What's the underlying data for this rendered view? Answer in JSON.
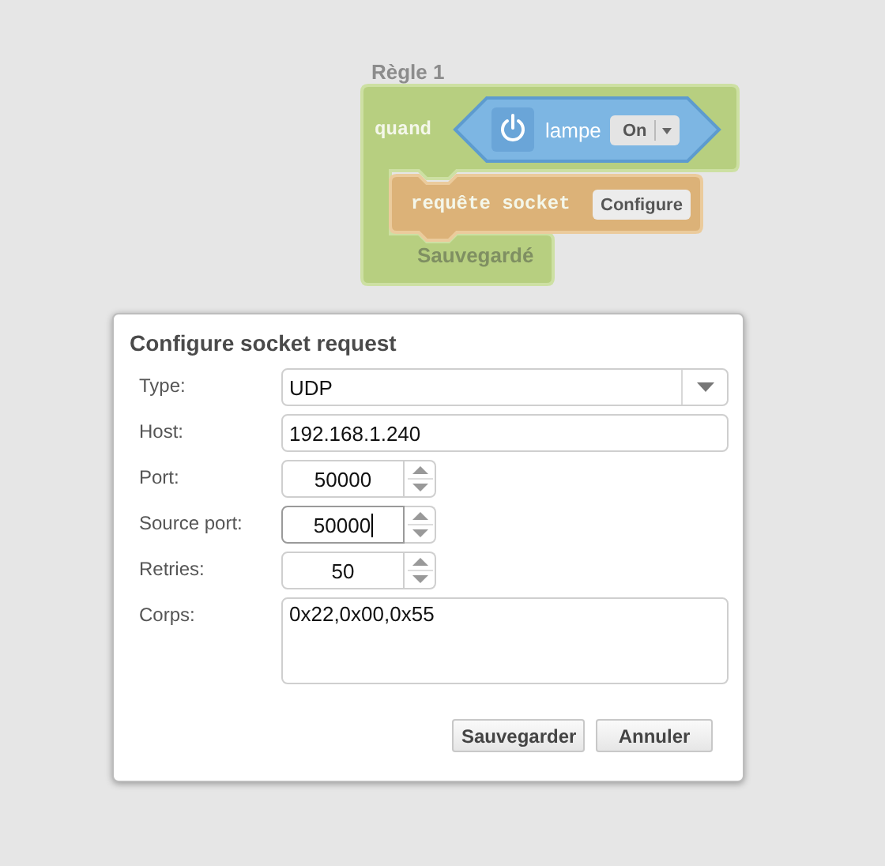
{
  "rule": {
    "title": "Règle 1",
    "when_label": "quand",
    "trigger": {
      "device": "lampe",
      "state": "On"
    },
    "action": {
      "label": "requête socket",
      "button": "Configure"
    },
    "status": "Sauvegardé"
  },
  "dialog": {
    "title": "Configure socket request",
    "fields": [
      {
        "kind": "select",
        "label": "Type:",
        "value": "UDP",
        "focused": false
      },
      {
        "kind": "text",
        "label": "Host:",
        "value": "192.168.1.240",
        "focused": false
      },
      {
        "kind": "number",
        "label": "Port:",
        "value": "50000",
        "focused": false
      },
      {
        "kind": "number",
        "label": "Source port:",
        "value": "50000",
        "focused": true
      },
      {
        "kind": "number",
        "label": "Retries:",
        "value": "50",
        "focused": false
      },
      {
        "kind": "textarea",
        "label": "Corps:",
        "value": "0x22,0x00,0x55",
        "focused": false
      }
    ],
    "buttons": [
      "Sauvegarder",
      "Annuler"
    ]
  }
}
